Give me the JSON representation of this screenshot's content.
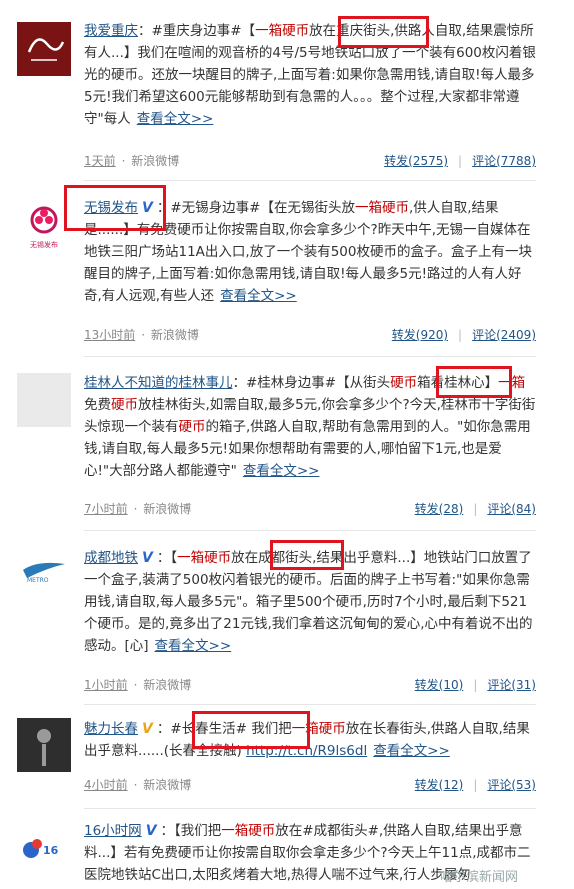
{
  "posts": [
    {
      "user": "我爱重庆",
      "before": "：#重庆身边事#【",
      "kw": "一箱硬币",
      "after": "放在重庆街头,供路人自取,结果震惊所有人...】我们在喧闹的观音桥的4号/5号地铁站口放了一个装有600枚闪着银光的硬币。还放一块醒目的牌子,上面写着:如果你急需用钱,请自取!每人最多5元!我们希望这600元能够帮助到有急需的人。。。整个过程,大家都非常遵守\"每人",
      "more": "查看全文>>",
      "time": "1天前",
      "source": "新浪微博",
      "forward": "转发(2575)",
      "comment": "评论(7788)"
    },
    {
      "user": "无锡发布",
      "before": "：#无锡身边事#【在无锡街头放",
      "kw": "一箱硬币",
      "after": ",供人自取,结果是......】有免费硬币让你按需自取,你会拿多少个?昨天中午,无锡一自媒体在地铁三阳广场站11A出入口,放了一个装有500枚硬币的盒子。盒子上有一块醒目的牌子,上面写着:如你急需用钱,请自取!每人最多5元!路过的人有人好奇,有人远观,有些人还",
      "more": "查看全文>>",
      "time": "13小时前",
      "source": "新浪微博",
      "forward": "转发(920)",
      "comment": "评论(2409)"
    },
    {
      "user": "桂林人不知道的桂林事儿",
      "before": "：#桂林身边事#【从街头",
      "kw": "硬币",
      "mid": "箱看桂林心】",
      "kw2": "一箱",
      "mid2": "免费",
      "kw3": "硬币",
      "mid3": "放桂林街头,如需自取,最多5元,你会拿多少个?今天,桂林市十字街街头惊现一个装有",
      "kw4": "硬币",
      "after": "的箱子,供路人自取,帮助有急需用到的人。\"如你急需用钱,请自取,每人最多5元!如果你想帮助有需要的人,哪怕留下1元,也是爱心!\"大部分路人都能遵守\"",
      "more": "查看全文>>",
      "time": "7小时前",
      "source": "新浪微博",
      "forward": "转发(28)",
      "comment": "评论(84)"
    },
    {
      "user": "成都地铁",
      "before": "：【",
      "kw": "一箱硬币",
      "after": "放在成都街头,结果出乎意料...】地铁站门口放置了一个盒子,装满了500枚闪着银光的硬币。后面的牌子上书写着:\"如果你急需用钱,请自取,每人最多5元\"。箱子里500个硬币,历时7个小时,最后剩下521个硬币。是的,竟多出了21元钱,我们拿着这沉甸甸的爱心,心中有着说不出的感动。[心]",
      "more": "查看全文>>",
      "time": "1小时前",
      "source": "新浪微博",
      "forward": "转发(10)",
      "comment": "评论(31)"
    },
    {
      "user": "魅力长春",
      "before": "：#长春生活# 我们把",
      "kw": "一箱硬币",
      "after": "放在长春街头,供路人自取,结果出乎意料......(长春全接触) ",
      "link": "http://t.cn/R9ls6dl",
      "more": "查看全文>>",
      "time": "4小时前",
      "source": "新浪微博",
      "forward": "转发(12)",
      "comment": "评论(53)"
    },
    {
      "user": "16小时网",
      "before": "：【我们把",
      "kw": "一箱硬币",
      "after": "放在#成都街头#,供路人自取,结果出乎意料...】若有免费硬币让你按需自取你会拿走多少个?今天上午11点,成都市二医院地铁站C出口,太阳炙烤着大地,热得人喘不过气来,行人步履匆",
      "more": "",
      "time": "",
      "source": "",
      "forward": "",
      "comment": ""
    }
  ],
  "watermark": "哈尔滨新闻网",
  "colors": {
    "link": "#225588",
    "keyword": "#c00000",
    "highlight": "#e0141e"
  }
}
